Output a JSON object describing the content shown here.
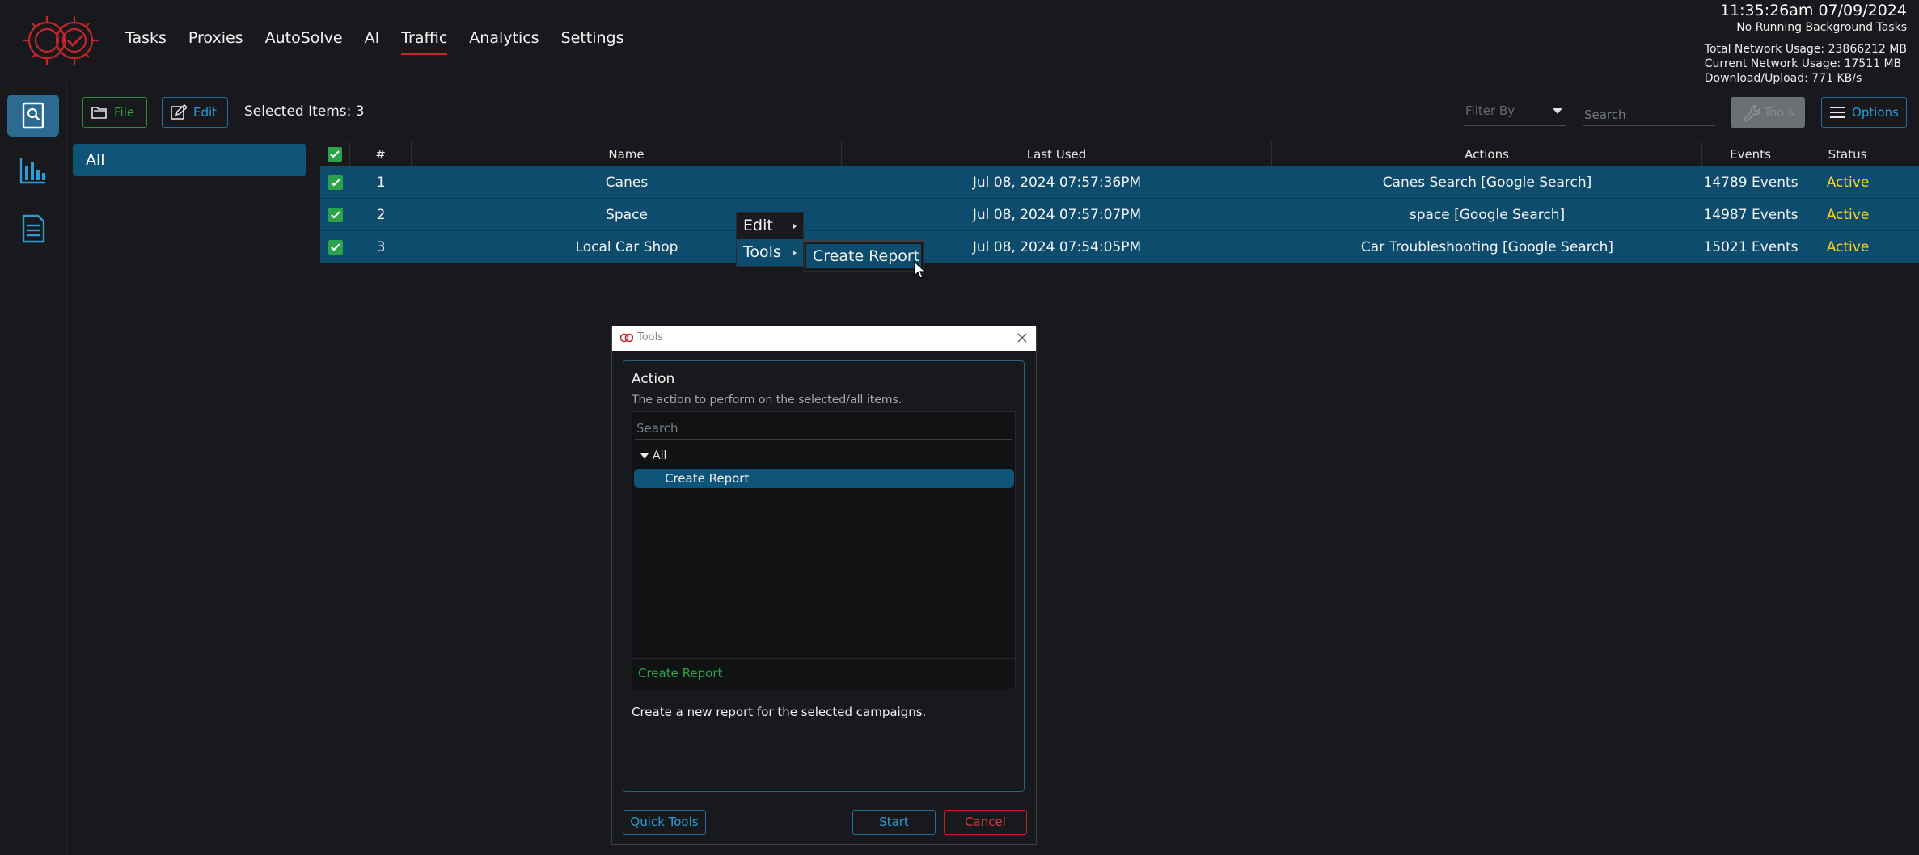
{
  "header": {
    "nav": [
      {
        "label": "Tasks",
        "active": false
      },
      {
        "label": "Proxies",
        "active": false
      },
      {
        "label": "AutoSolve",
        "active": false
      },
      {
        "label": "AI",
        "active": false
      },
      {
        "label": "Traffic",
        "active": true
      },
      {
        "label": "Analytics",
        "active": false
      },
      {
        "label": "Settings",
        "active": false
      }
    ],
    "clock": "11:35:26am 07/09/2024",
    "background_tasks": "No Running Background Tasks",
    "total_network": "Total Network Usage:  23866212 MB",
    "current_network": "Current Network Usage: 17511 MB",
    "download_upload": "Download/Upload: 771 KB/s"
  },
  "rail": {
    "items": [
      "search-book-icon",
      "bar-chart-icon",
      "document-icon"
    ],
    "active_index": 0
  },
  "groups": {
    "items": [
      "All"
    ]
  },
  "toolbar": {
    "file_label": "File",
    "edit_label": "Edit",
    "selected_items": "Selected Items: 3",
    "filter_placeholder": "Filter By",
    "search_placeholder": "Search",
    "tools_label": "Tools",
    "options_label": "Options"
  },
  "table": {
    "headers": [
      "#",
      "Name",
      "Last Used",
      "Actions",
      "Events",
      "Status"
    ],
    "rows": [
      {
        "num": "1",
        "name": "Canes",
        "last_used": "Jul 08, 2024 07:57:36PM",
        "actions": "Canes Search [Google Search]",
        "events": "14789 Events",
        "status": "Active"
      },
      {
        "num": "2",
        "name": "Space",
        "last_used": "Jul 08, 2024 07:57:07PM",
        "actions": "space [Google Search]",
        "events": "14987 Events",
        "status": "Active"
      },
      {
        "num": "3",
        "name": "Local Car Shop",
        "last_used": "Jul 08, 2024 07:54:05PM",
        "actions": "Car Troubleshooting [Google Search]",
        "events": "15021 Events",
        "status": "Active"
      }
    ]
  },
  "context_menu": {
    "items": [
      "Edit",
      "Tools"
    ],
    "submenu": [
      "Create Report"
    ]
  },
  "dialog": {
    "title": "Tools",
    "heading": "Action",
    "description": "The action to perform on the selected/all items.",
    "search_placeholder": "Search",
    "tree_root": "All",
    "tree_item": "Create Report",
    "selected_label": "Create Report",
    "help_text": "Create a new report for the selected campaigns.",
    "quick_tools_label": "Quick Tools",
    "start_label": "Start",
    "cancel_label": "Cancel"
  },
  "colors": {
    "background": "#17191c",
    "accent_blue": "#0e4c6e",
    "brand_red": "#c0262a",
    "status_active": "#ffd51e",
    "green": "#2aa34a"
  }
}
